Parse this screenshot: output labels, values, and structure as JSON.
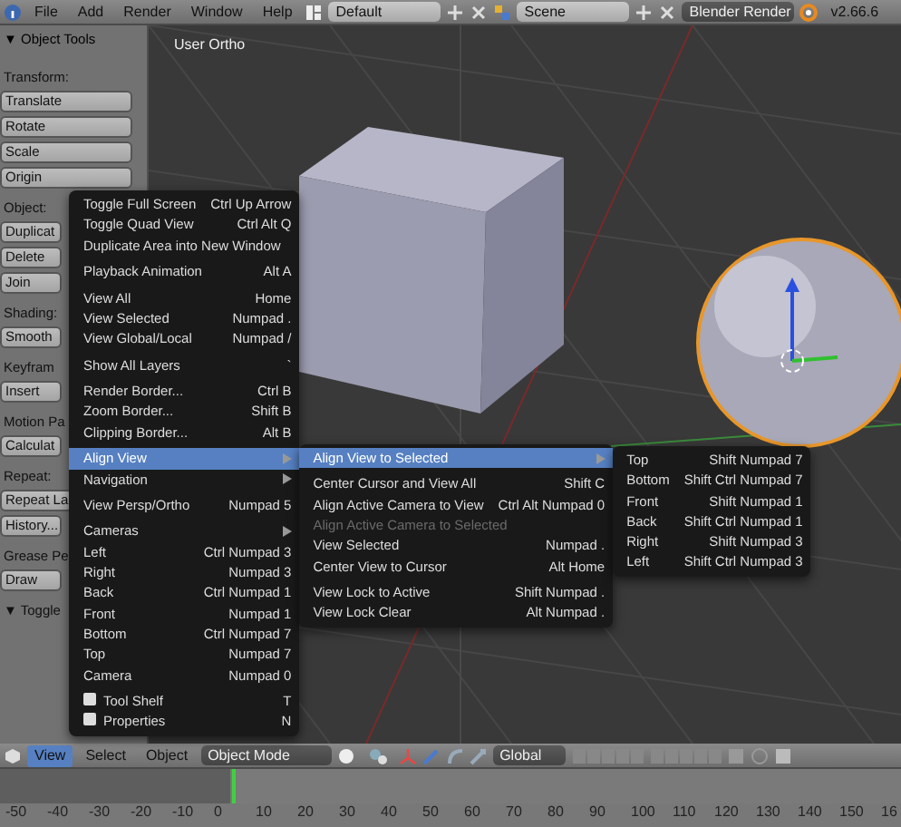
{
  "top_header": {
    "menus": [
      "File",
      "Add",
      "Render",
      "Window",
      "Help"
    ],
    "layout": "Default",
    "scene": "Scene",
    "engine": "Blender Render",
    "version": "v2.66.6"
  },
  "tool_shelf": {
    "title": "▼ Object Tools",
    "items": [
      {
        "kind": "heading",
        "label": "Transform:"
      },
      {
        "kind": "button",
        "label": "Translate"
      },
      {
        "kind": "button",
        "label": "Rotate"
      },
      {
        "kind": "button",
        "label": "Scale"
      },
      {
        "kind": "button",
        "label": "Origin"
      },
      {
        "kind": "heading",
        "label": "Object:"
      },
      {
        "kind": "button",
        "label": "Duplicat"
      },
      {
        "kind": "button",
        "label": "Delete"
      },
      {
        "kind": "button",
        "label": "Join"
      },
      {
        "kind": "heading",
        "label": "Shading:"
      },
      {
        "kind": "button",
        "label": "Smooth"
      },
      {
        "kind": "heading",
        "label": "Keyfram"
      },
      {
        "kind": "button",
        "label": "Insert"
      },
      {
        "kind": "heading",
        "label": "Motion Pa"
      },
      {
        "kind": "button",
        "label": "Calculat"
      },
      {
        "kind": "heading",
        "label": "Repeat:"
      },
      {
        "kind": "button",
        "label": "Repeat La"
      },
      {
        "kind": "button",
        "label": "History..."
      },
      {
        "kind": "heading",
        "label": "Grease Pe"
      },
      {
        "kind": "button",
        "label": "Draw"
      }
    ],
    "footer": "▼ Toggle"
  },
  "viewport": {
    "label": "User Ortho"
  },
  "view_menu": [
    {
      "kind": "item",
      "label": "Toggle Full Screen",
      "shortcut": "Ctrl Up Arrow",
      "selected": false
    },
    {
      "kind": "item",
      "label": "Toggle Quad View",
      "shortcut": "Ctrl Alt Q",
      "selected": false
    },
    {
      "kind": "item",
      "label": "Duplicate Area into New Window",
      "selected": false
    },
    {
      "kind": "separator"
    },
    {
      "kind": "item",
      "label": "Playback Animation",
      "shortcut": "Alt A",
      "selected": false
    },
    {
      "kind": "separator"
    },
    {
      "kind": "item",
      "label": "View All",
      "shortcut": "Home",
      "selected": false
    },
    {
      "kind": "item",
      "label": "View Selected",
      "shortcut": "Numpad .",
      "selected": false
    },
    {
      "kind": "item",
      "label": "View Global/Local",
      "shortcut": "Numpad /",
      "selected": false
    },
    {
      "kind": "separator"
    },
    {
      "kind": "item",
      "label": "Show All Layers",
      "shortcut": "`",
      "selected": false
    },
    {
      "kind": "separator"
    },
    {
      "kind": "item",
      "label": "Render Border...",
      "shortcut": "Ctrl B",
      "selected": false
    },
    {
      "kind": "item",
      "label": "Zoom Border...",
      "shortcut": "Shift B",
      "selected": false
    },
    {
      "kind": "item",
      "label": "Clipping Border...",
      "shortcut": "Alt B",
      "selected": false
    },
    {
      "kind": "separator"
    },
    {
      "kind": "submenu",
      "label": "Align View",
      "selected": true
    },
    {
      "kind": "submenu",
      "label": "Navigation",
      "selected": false
    },
    {
      "kind": "separator"
    },
    {
      "kind": "item",
      "label": "View Persp/Ortho",
      "shortcut": "Numpad 5",
      "selected": false
    },
    {
      "kind": "separator"
    },
    {
      "kind": "submenu",
      "label": "Cameras",
      "selected": false
    },
    {
      "kind": "item",
      "label": "Left",
      "shortcut": "Ctrl Numpad 3",
      "selected": false
    },
    {
      "kind": "item",
      "label": "Right",
      "shortcut": "Numpad 3",
      "selected": false
    },
    {
      "kind": "item",
      "label": "Back",
      "shortcut": "Ctrl Numpad 1",
      "selected": false
    },
    {
      "kind": "item",
      "label": "Front",
      "shortcut": "Numpad 1",
      "selected": false
    },
    {
      "kind": "item",
      "label": "Bottom",
      "shortcut": "Ctrl Numpad 7",
      "selected": false
    },
    {
      "kind": "item",
      "label": "Top",
      "shortcut": "Numpad 7",
      "selected": false
    },
    {
      "kind": "item",
      "label": "Camera",
      "shortcut": "Numpad 0",
      "selected": false
    },
    {
      "kind": "separator"
    },
    {
      "kind": "check",
      "label": "Tool Shelf",
      "shortcut": "T",
      "checked": false,
      "selected": false
    },
    {
      "kind": "check",
      "label": "Properties",
      "shortcut": "N",
      "checked": false,
      "selected": false
    }
  ],
  "align_menu": [
    {
      "kind": "submenu",
      "label": "Align View to Selected",
      "selected": true,
      "disabled": false
    },
    {
      "kind": "separator"
    },
    {
      "kind": "item",
      "label": "Center Cursor and View All",
      "shortcut": "Shift C",
      "selected": false,
      "disabled": false
    },
    {
      "kind": "item",
      "label": "Align Active Camera to View",
      "shortcut": "Ctrl Alt Numpad 0",
      "selected": false,
      "disabled": false
    },
    {
      "kind": "item",
      "label": "Align Active Camera to Selected",
      "selected": false,
      "disabled": true
    },
    {
      "kind": "item",
      "label": "View Selected",
      "shortcut": "Numpad .",
      "selected": false,
      "disabled": false
    },
    {
      "kind": "item",
      "label": "Center View to Cursor",
      "shortcut": "Alt Home",
      "selected": false,
      "disabled": false
    },
    {
      "kind": "separator"
    },
    {
      "kind": "item",
      "label": "View Lock to Active",
      "shortcut": "Shift Numpad .",
      "selected": false,
      "disabled": false
    },
    {
      "kind": "item",
      "label": "View Lock Clear",
      "shortcut": "Alt Numpad .",
      "selected": false,
      "disabled": false
    }
  ],
  "selected_menu": [
    {
      "kind": "item",
      "label": "Top",
      "shortcut": "Shift Numpad 7",
      "selected": false
    },
    {
      "kind": "item",
      "label": "Bottom",
      "shortcut": "Shift Ctrl Numpad 7",
      "selected": false
    },
    {
      "kind": "item",
      "label": "Front",
      "shortcut": "Shift Numpad 1",
      "selected": false
    },
    {
      "kind": "item",
      "label": "Back",
      "shortcut": "Shift Ctrl Numpad 1",
      "selected": false
    },
    {
      "kind": "item",
      "label": "Right",
      "shortcut": "Shift Numpad 3",
      "selected": false
    },
    {
      "kind": "item",
      "label": "Left",
      "shortcut": "Shift Ctrl Numpad 3",
      "selected": false
    }
  ],
  "bottom_header": {
    "menus": [
      {
        "label": "View",
        "selected": true
      },
      {
        "label": "Select",
        "selected": false
      },
      {
        "label": "Object",
        "selected": false
      }
    ],
    "mode": "Object Mode",
    "orientation": "Global"
  },
  "timeline": {
    "ticks": [
      "-50",
      "-40",
      "-30",
      "-20",
      "-10",
      "0",
      "10",
      "20",
      "30",
      "40",
      "50",
      "60",
      "70",
      "80",
      "90",
      "100",
      "110",
      "120",
      "130",
      "140",
      "150",
      "16"
    ]
  }
}
